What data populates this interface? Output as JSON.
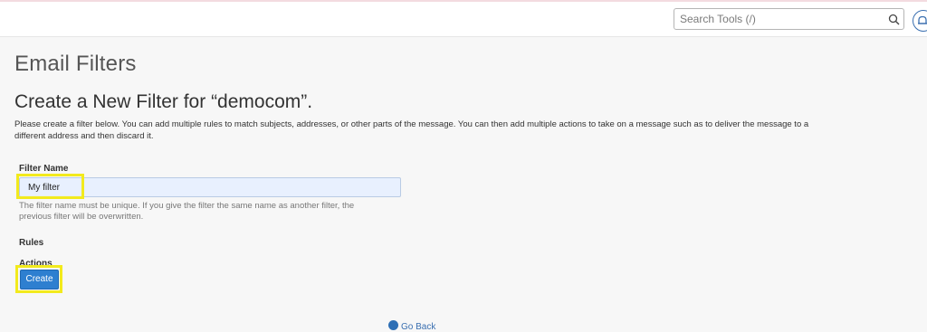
{
  "header": {
    "search": {
      "placeholder": "Search Tools (/)",
      "icon": "search-icon"
    },
    "notifications_icon": "bell-icon"
  },
  "page": {
    "title": "Email Filters",
    "heading": "Create a New Filter for “democom”.",
    "description": "Please create a filter below. You can add multiple rules to match subjects, addresses, or other parts of the message. You can then add multiple actions to take on a message such as to deliver the message to a different address and then discard it."
  },
  "form": {
    "filter_name_label": "Filter Name",
    "filter_name_value": "My filter",
    "filter_name_help": "The filter name must be unique. If you give the filter the same name as another filter, the previous filter will be overwritten.",
    "rules_label": "Rules",
    "actions_label": "Actions",
    "create_label": "Create"
  },
  "footer": {
    "go_back_label": "Go Back"
  },
  "colors": {
    "accent": "#2e7fd0",
    "highlight": "#f2ea1d",
    "input_bg": "#e8f0fe"
  }
}
